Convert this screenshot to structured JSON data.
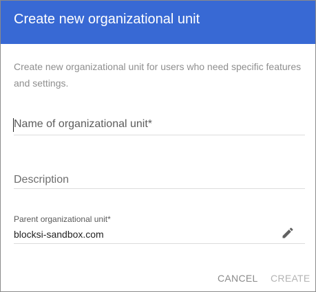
{
  "dialog": {
    "title": "Create new organizational unit",
    "description": "Create new organizational unit for users who need specific features and settings.",
    "header_color": "#3869d4"
  },
  "form": {
    "name_label": "Name of organizational unit*",
    "description_label": "Description",
    "parent_label": "Parent organizational unit*",
    "parent_value": "blocksi-sandbox.com",
    "edit_icon": "pencil-icon"
  },
  "actions": {
    "cancel_label": "CANCEL",
    "create_label": "CREATE"
  }
}
